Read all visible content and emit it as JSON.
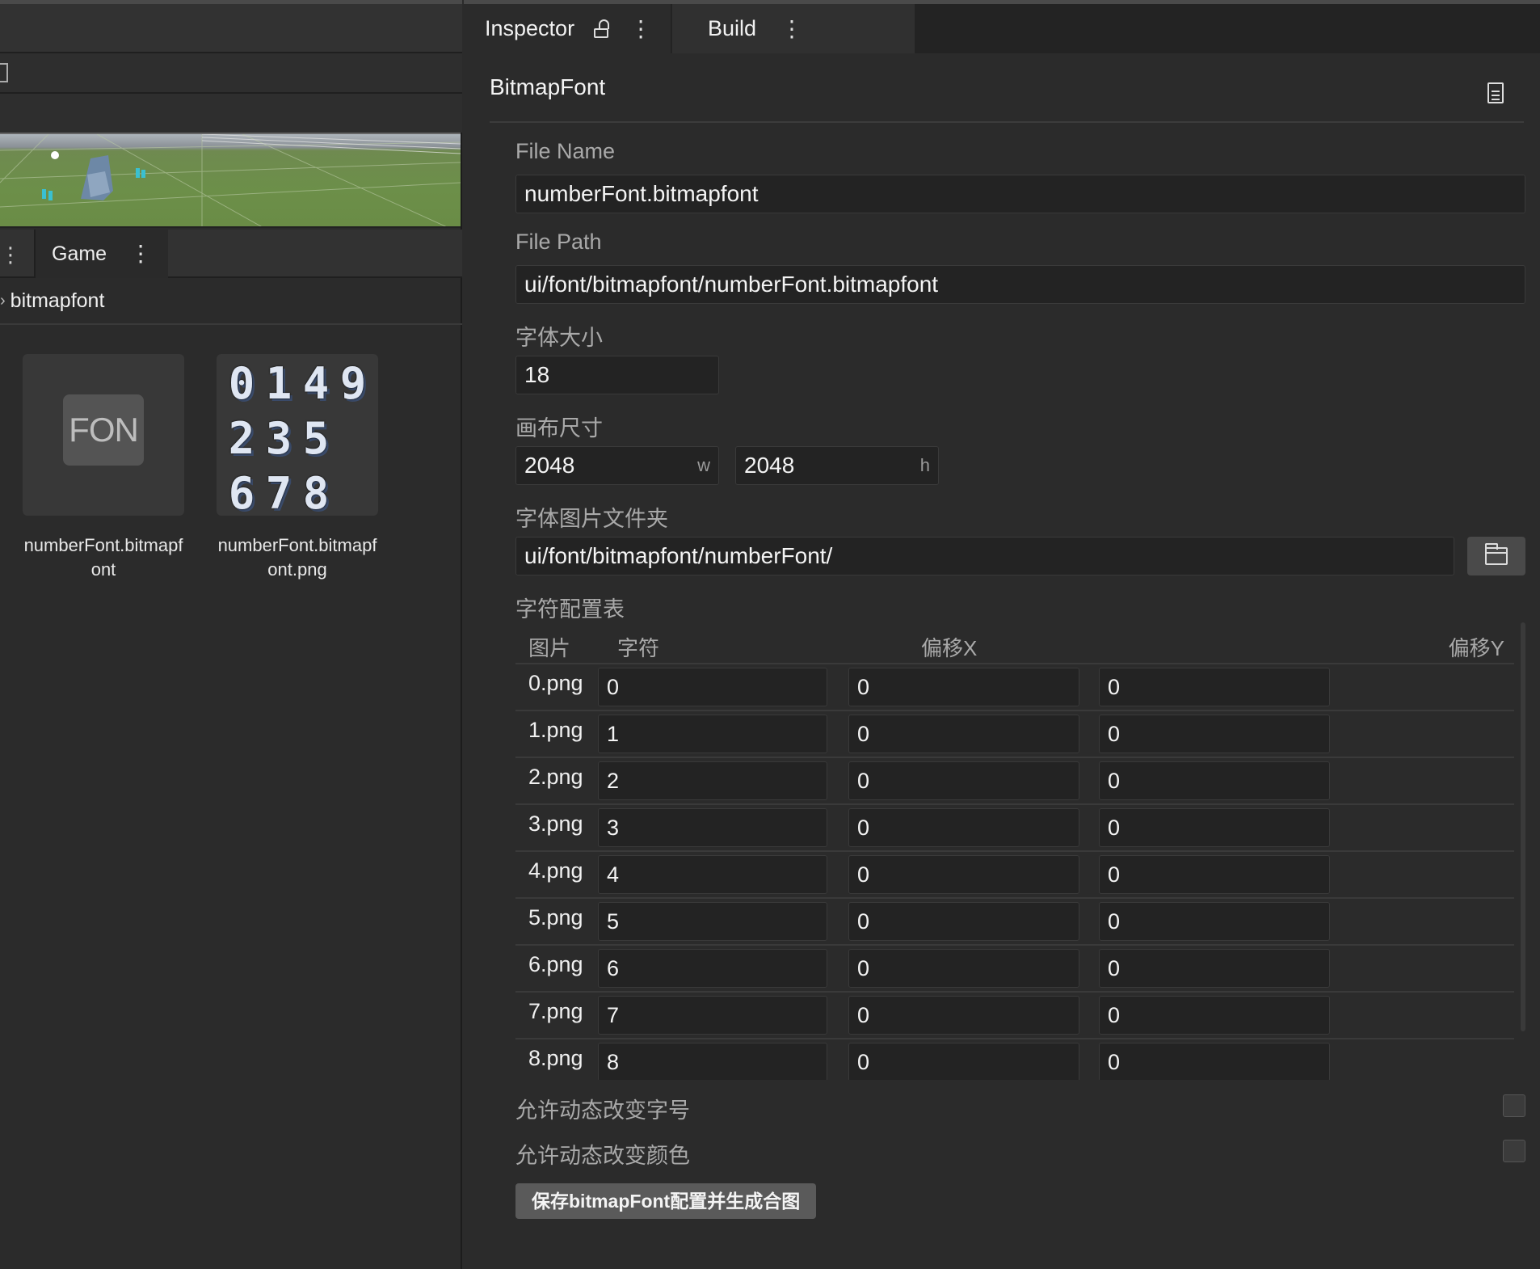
{
  "left": {
    "game_tab_label": "Game",
    "breadcrumb": "bitmapfont",
    "assets": [
      {
        "name": "numberFont.bitmapfont",
        "badge": "FON"
      },
      {
        "name": "numberFont.bitmapfont.png",
        "glyphs": [
          "0",
          "1",
          "4",
          "9",
          "2",
          "3",
          "5",
          "",
          "6",
          "7",
          "8",
          ""
        ]
      }
    ]
  },
  "inspector": {
    "tabs": {
      "inspector": "Inspector",
      "build": "Build"
    },
    "title": "BitmapFont",
    "file_name_label": "File Name",
    "file_name": "numberFont.bitmapfont",
    "file_path_label": "File Path",
    "file_path": "ui/font/bitmapfont/numberFont.bitmapfont",
    "font_size_label": "字体大小",
    "font_size": "18",
    "canvas_label": "画布尺寸",
    "canvas_w": "2048",
    "canvas_w_suffix": "w",
    "canvas_h": "2048",
    "canvas_h_suffix": "h",
    "folder_label": "字体图片文件夹",
    "folder": "ui/font/bitmapfont/numberFont/",
    "table_label": "字符配置表",
    "table_headers": {
      "image": "图片",
      "char": "字符",
      "offset_x": "偏移X",
      "offset_y": "偏移Y"
    },
    "rows": [
      {
        "image": "0.png",
        "char": "0",
        "x": "0",
        "y": "0"
      },
      {
        "image": "1.png",
        "char": "1",
        "x": "0",
        "y": "0"
      },
      {
        "image": "2.png",
        "char": "2",
        "x": "0",
        "y": "0"
      },
      {
        "image": "3.png",
        "char": "3",
        "x": "0",
        "y": "0"
      },
      {
        "image": "4.png",
        "char": "4",
        "x": "0",
        "y": "0"
      },
      {
        "image": "5.png",
        "char": "5",
        "x": "0",
        "y": "0"
      },
      {
        "image": "6.png",
        "char": "6",
        "x": "0",
        "y": "0"
      },
      {
        "image": "7.png",
        "char": "7",
        "x": "0",
        "y": "0"
      },
      {
        "image": "8.png",
        "char": "8",
        "x": "0",
        "y": "0"
      }
    ],
    "dynamic_size_label": "允许动态改变字号",
    "dynamic_size": false,
    "dynamic_color_label": "允许动态改变颜色",
    "dynamic_color": false,
    "save_button": "保存bitmapFont配置并生成合图"
  }
}
